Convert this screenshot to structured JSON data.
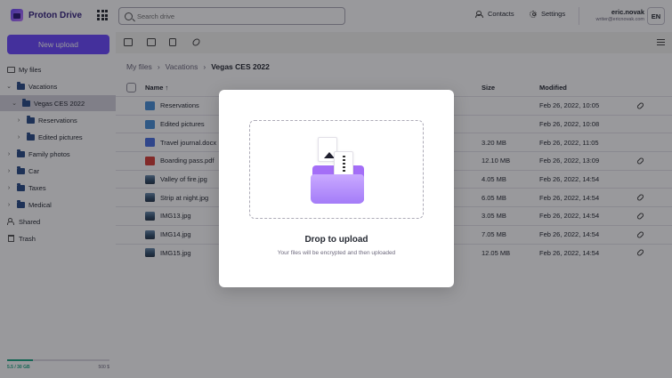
{
  "app": {
    "brand": "Proton Drive"
  },
  "header": {
    "search_placeholder": "Search drive",
    "contacts_label": "Contacts",
    "settings_label": "Settings",
    "user_name": "eric.novak",
    "user_email": "writer@ericnovak.com",
    "avatar_initials": "EN"
  },
  "sidebar": {
    "new_upload_label": "New upload",
    "items": [
      {
        "label": "My files",
        "icon": "my-files-icon"
      },
      {
        "label": "Vacations",
        "icon": "folder-icon"
      },
      {
        "label": "Vegas CES 2022",
        "icon": "folder-icon",
        "active": true
      },
      {
        "label": "Reservations",
        "icon": "folder-icon"
      },
      {
        "label": "Edited pictures",
        "icon": "folder-icon"
      },
      {
        "label": "Family photos",
        "icon": "folder-icon"
      },
      {
        "label": "Car",
        "icon": "folder-icon"
      },
      {
        "label": "Taxes",
        "icon": "folder-icon"
      },
      {
        "label": "Medical",
        "icon": "folder-icon"
      },
      {
        "label": "Shared",
        "icon": "shared-icon"
      },
      {
        "label": "Trash",
        "icon": "trash-icon"
      }
    ],
    "storage": {
      "used": "5.5 / 30 GB",
      "right": "500 $",
      "fraction": 0.25
    }
  },
  "breadcrumb": [
    "My files",
    "Vacations",
    "Vegas CES 2022"
  ],
  "table": {
    "headers": {
      "name": "Name ↑",
      "size": "Size",
      "modified": "Modified"
    },
    "rows": [
      {
        "name": "Reservations",
        "type": "folder",
        "size": "",
        "modified": "Feb 26, 2022, 10:05",
        "shared": true
      },
      {
        "name": "Edited pictures",
        "type": "folder",
        "size": "",
        "modified": "Feb 26, 2022, 10:08",
        "shared": false
      },
      {
        "name": "Travel journal.docx",
        "type": "docx",
        "size": "3.20 MB",
        "modified": "Feb 26, 2022, 11:05",
        "shared": false
      },
      {
        "name": "Boarding pass.pdf",
        "type": "pdf",
        "size": "12.10 MB",
        "modified": "Feb 26, 2022, 13:09",
        "shared": true
      },
      {
        "name": "Valley of fire.jpg",
        "type": "img",
        "size": "4.05 MB",
        "modified": "Feb 26, 2022, 14:54",
        "shared": false
      },
      {
        "name": "Strip at night.jpg",
        "type": "img",
        "size": "6.05 MB",
        "modified": "Feb 26, 2022, 14:54",
        "shared": true
      },
      {
        "name": "IMG13.jpg",
        "type": "img",
        "size": "3.05 MB",
        "modified": "Feb 26, 2022, 14:54",
        "shared": true
      },
      {
        "name": "IMG14.jpg",
        "type": "img",
        "size": "7.05 MB",
        "modified": "Feb 26, 2022, 14:54",
        "shared": true
      },
      {
        "name": "IMG15.jpg",
        "type": "img",
        "size": "12.05 MB",
        "modified": "Feb 26, 2022, 14:54",
        "shared": true
      }
    ]
  },
  "modal": {
    "title": "Drop to upload",
    "subtitle": "Your files will be encrypted and then uploaded"
  },
  "colors": {
    "accent": "#6d4aff",
    "folder": "#4a91d8",
    "storage": "#1ea885"
  }
}
